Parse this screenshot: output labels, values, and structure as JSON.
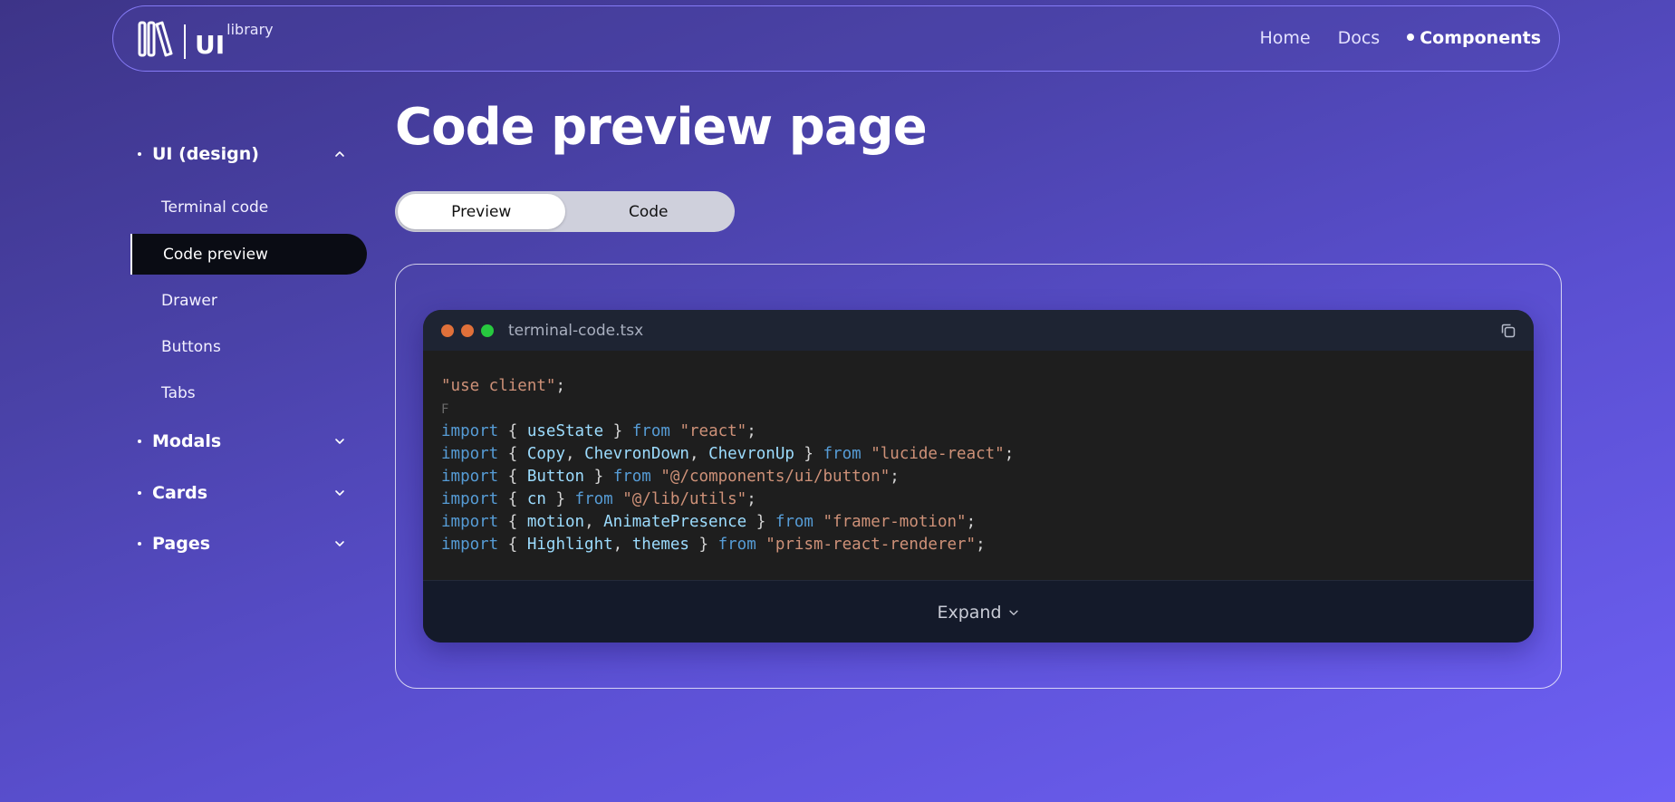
{
  "header": {
    "logo_ui": "UI",
    "logo_library": "library",
    "nav": [
      {
        "label": "Home"
      },
      {
        "label": "Docs"
      },
      {
        "label": "Components"
      }
    ]
  },
  "sidebar": {
    "groups": [
      {
        "label": "UI (design)",
        "expanded": true,
        "icon": "chevron-up-icon"
      },
      {
        "label": "Modals",
        "expanded": false,
        "icon": "chevron-down-icon"
      },
      {
        "label": "Cards",
        "expanded": false,
        "icon": "chevron-down-icon"
      },
      {
        "label": "Pages",
        "expanded": false,
        "icon": "chevron-down-icon"
      }
    ],
    "sub_items": [
      {
        "label": "Terminal code"
      },
      {
        "label": "Code preview",
        "active": true
      },
      {
        "label": "Drawer"
      },
      {
        "label": "Buttons"
      },
      {
        "label": "Tabs"
      }
    ]
  },
  "main": {
    "title": "Code preview page",
    "tabs": [
      {
        "label": "Preview",
        "active": true
      },
      {
        "label": "Code"
      }
    ]
  },
  "code_window": {
    "filename": "terminal-code.tsx",
    "traffic_lights": [
      "#e0703a",
      "#e0703a",
      "#27c93f"
    ],
    "stray_char": "F",
    "expand_label": "Expand",
    "tokens": {
      "use_client": "\"use client\"",
      "semicolon": ";",
      "import": "import",
      "from": "from",
      "open": "{ ",
      "close": " }",
      "comma": ", ",
      "l1": {
        "names": [
          "useState"
        ],
        "module": "\"react\""
      },
      "l2": {
        "names": [
          "Copy",
          "ChevronDown",
          "ChevronUp"
        ],
        "module": "\"lucide-react\""
      },
      "l3": {
        "names": [
          "Button"
        ],
        "module": "\"@/components/ui/button\""
      },
      "l4": {
        "names": [
          "cn"
        ],
        "module": "\"@/lib/utils\""
      },
      "l5": {
        "names": [
          "motion",
          "AnimatePresence"
        ],
        "module": "\"framer-motion\""
      },
      "l6": {
        "names": [
          "Highlight",
          "themes"
        ],
        "module": "\"prism-react-renderer\""
      }
    }
  },
  "colors": {
    "keyword": "#569cd6",
    "string": "#ce9178",
    "identifier": "#9cdcfe",
    "active_sidebar_bg": "#0a0c14"
  }
}
